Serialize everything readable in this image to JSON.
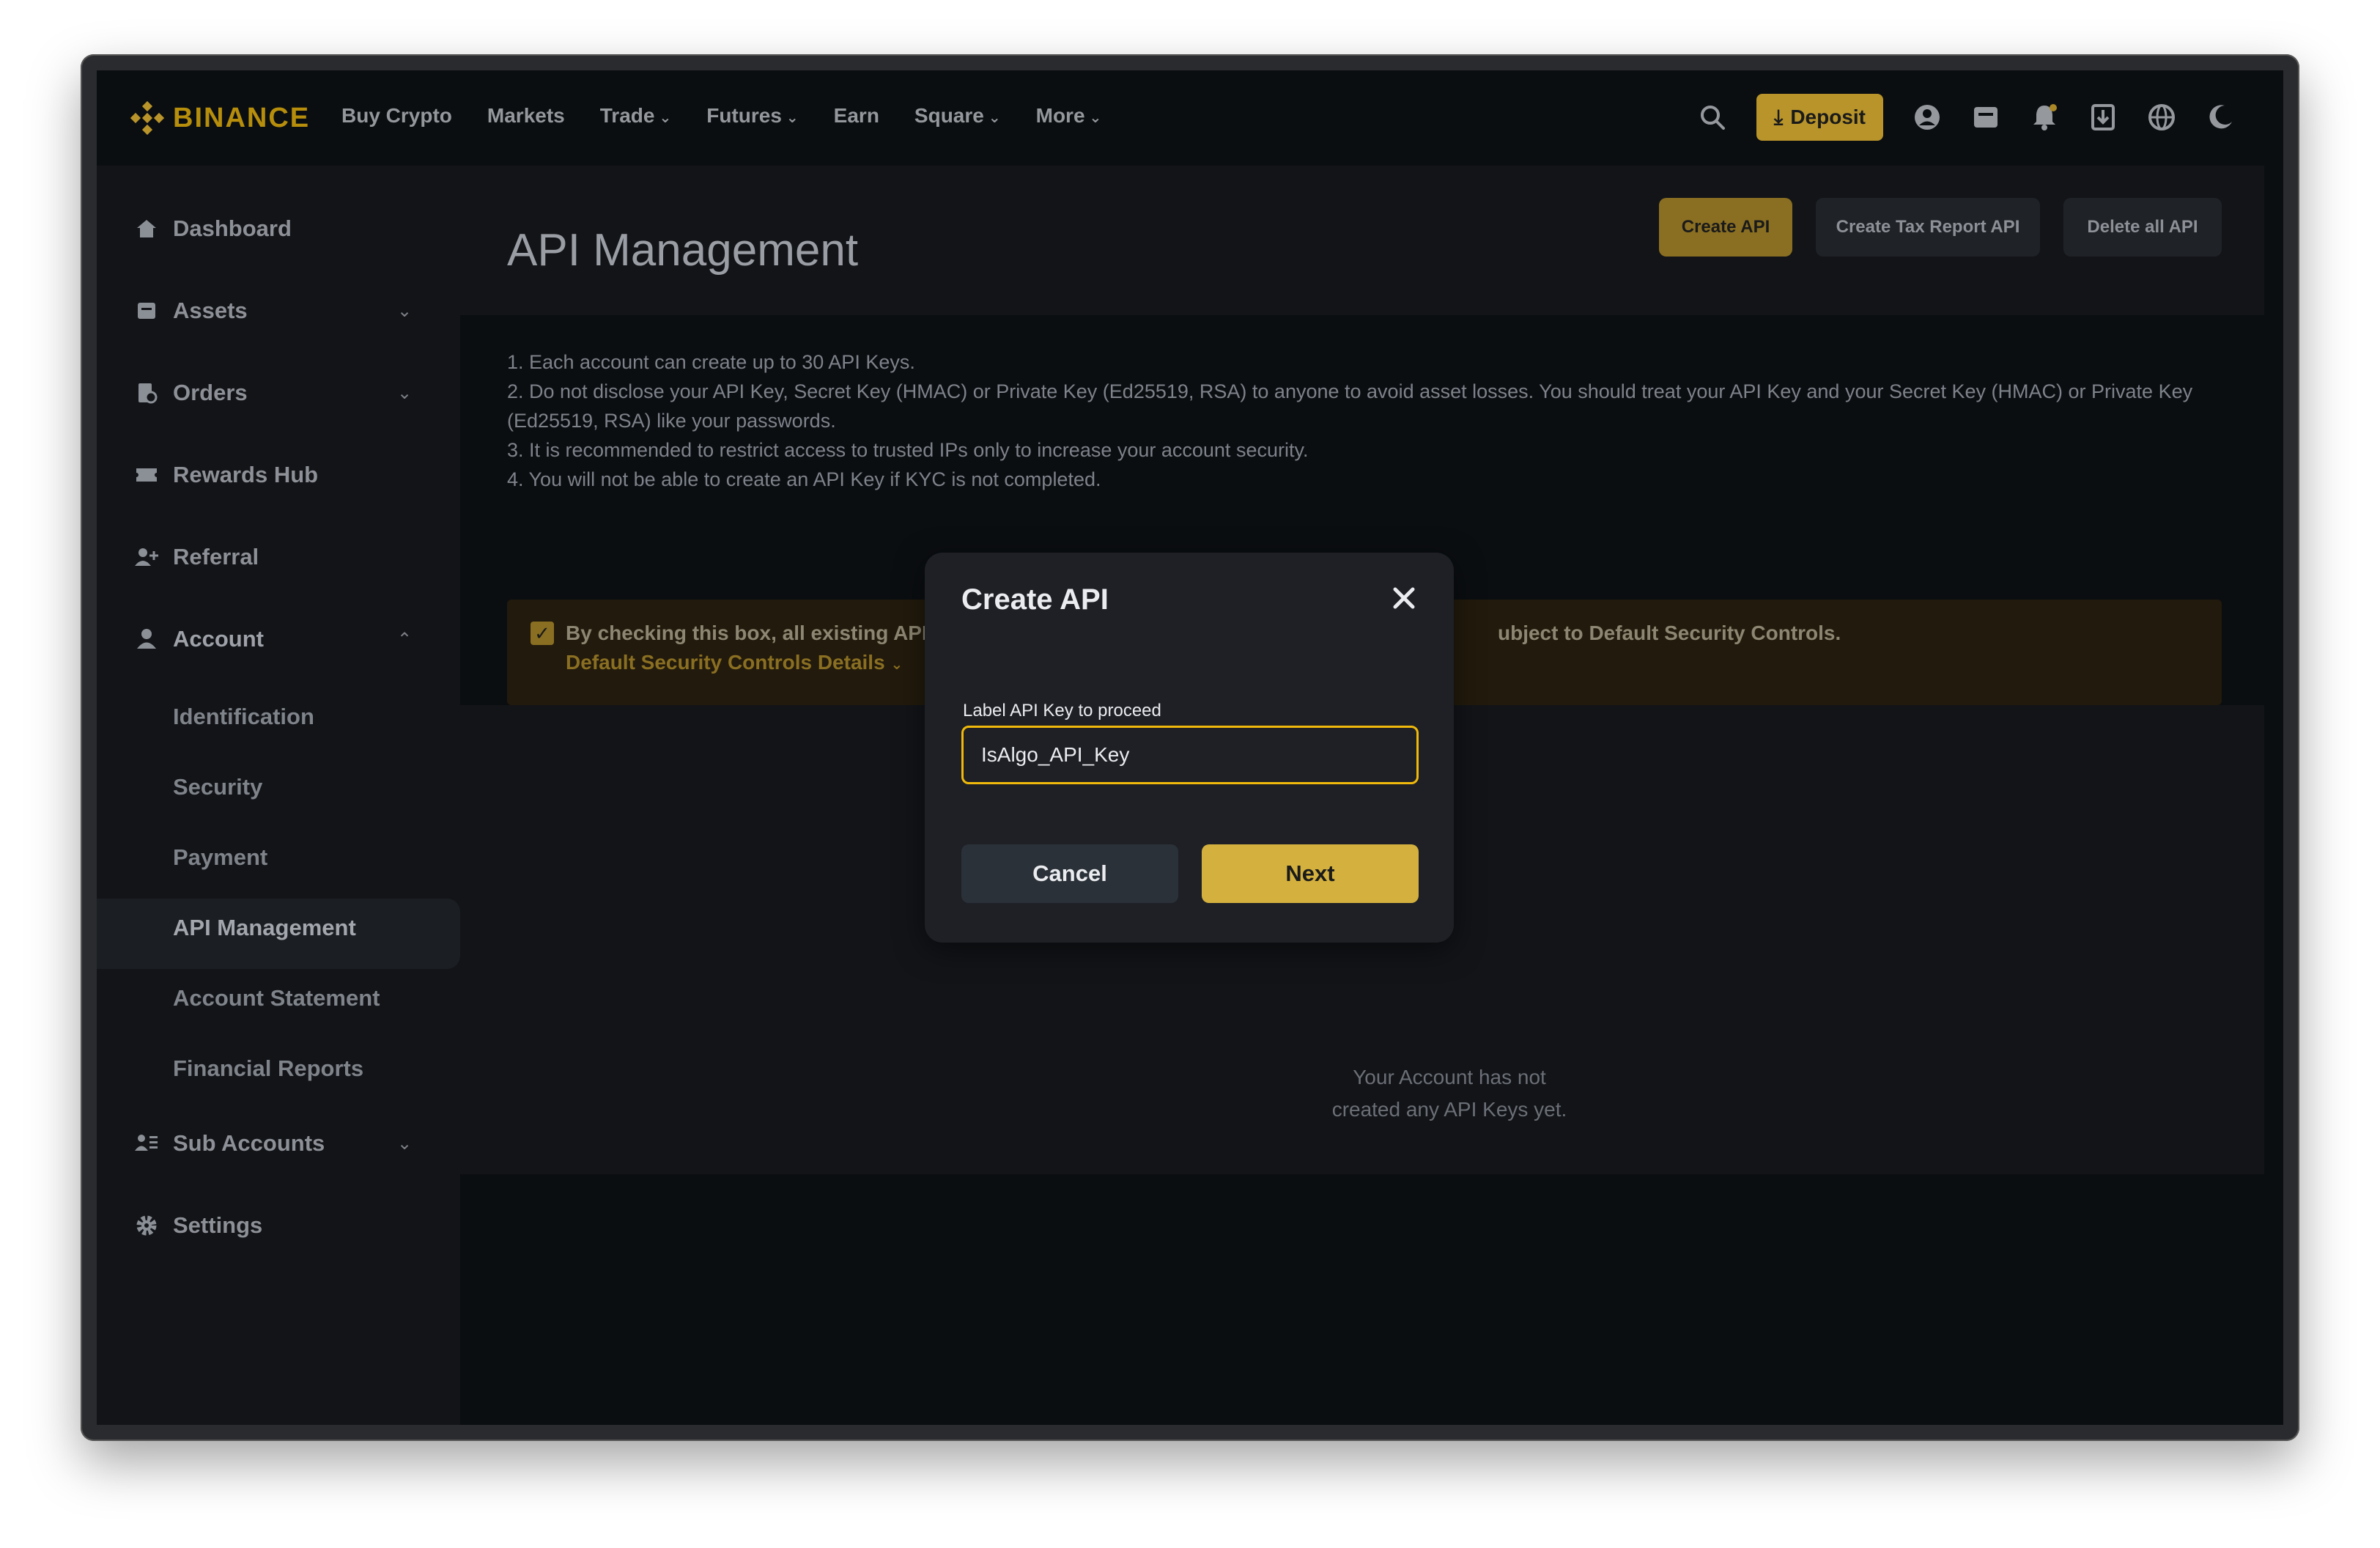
{
  "nav": {
    "logo_text": "BINANCE",
    "links": [
      {
        "label": "Buy Crypto",
        "has_dropdown": false
      },
      {
        "label": "Markets",
        "has_dropdown": false
      },
      {
        "label": "Trade",
        "has_dropdown": true
      },
      {
        "label": "Futures",
        "has_dropdown": true
      },
      {
        "label": "Earn",
        "has_dropdown": false
      },
      {
        "label": "Square",
        "has_dropdown": true
      },
      {
        "label": "More",
        "has_dropdown": true
      }
    ],
    "deposit_label": "Deposit",
    "icons": [
      "search-icon",
      "download-icon",
      "user-icon",
      "wallet-icon",
      "bell-icon",
      "download-app-icon",
      "globe-icon",
      "moon-icon"
    ]
  },
  "sidebar": {
    "items": [
      {
        "label": "Dashboard",
        "icon": "home-icon"
      },
      {
        "label": "Assets",
        "icon": "wallet-icon"
      },
      {
        "label": "Orders",
        "icon": "orders-icon"
      },
      {
        "label": "Rewards Hub",
        "icon": "ticket-icon"
      },
      {
        "label": "Referral",
        "icon": "user-plus-icon"
      },
      {
        "label": "Account",
        "icon": "user-icon"
      },
      {
        "label": "Sub Accounts",
        "icon": "users-icon"
      },
      {
        "label": "Settings",
        "icon": "gear-icon"
      }
    ],
    "account_sub": [
      "Identification",
      "Security",
      "Payment",
      "API Management",
      "Account Statement",
      "Financial Reports"
    ]
  },
  "main": {
    "title": "API Management",
    "buttons": {
      "create": "Create API",
      "tax": "Create Tax Report API",
      "delete": "Delete all API"
    },
    "notes": [
      "1. Each account can create up to 30 API Keys.",
      "2. Do not disclose your API Key, Secret Key (HMAC) or Private Key (Ed25519, RSA) to anyone to avoid asset losses. You should treat your API Key and your Secret Key (HMAC) or Private Key (Ed25519, RSA) like your passwords.",
      "3. It is recommended to restrict access to trusted IPs only to increase your account security.",
      "4. You will not be able to create an API Key if KYC is not completed."
    ],
    "banner_text_left": "By checking this box, all existing API K",
    "banner_text_right": "ubject to Default Security Controls.",
    "banner_link": "Default Security Controls Details",
    "empty_line1": "Your Account has not",
    "empty_line2": "created any API Keys yet."
  },
  "modal": {
    "title": "Create API",
    "field_label": "Label API Key to proceed",
    "field_value": "IsAlgo_API_Key",
    "cancel": "Cancel",
    "next": "Next"
  }
}
